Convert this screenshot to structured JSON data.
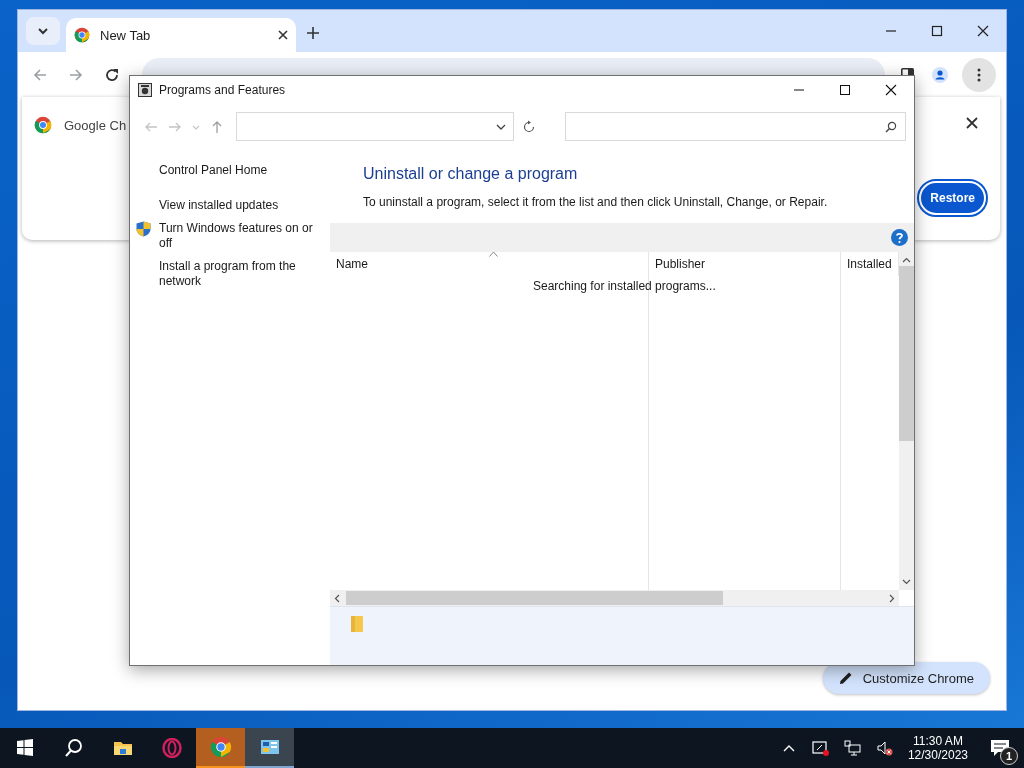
{
  "browser": {
    "tabs": [
      {
        "label": "New Tab",
        "selected": true
      }
    ],
    "card": {
      "site": "Google Ch",
      "button": "Restore"
    },
    "customize_button": "Customize Chrome"
  },
  "dialog": {
    "title": "Programs and Features",
    "sidebar": [
      {
        "label": "Control Panel Home",
        "kind": "link"
      },
      {
        "label": "View installed updates",
        "kind": "link"
      },
      {
        "label": "Turn Windows features on or off",
        "kind": "shield"
      },
      {
        "label": "Install a program from the network",
        "kind": "link"
      }
    ],
    "heading": "Uninstall or change a program",
    "description": "To uninstall a program, select it from the list and then click Uninstall, Change, or Repair.",
    "columns": [
      {
        "label": "Name",
        "sorted": true
      },
      {
        "label": "Publisher",
        "sorted": false
      },
      {
        "label": "Installed",
        "sorted": false
      }
    ],
    "status": "Searching for installed programs..."
  },
  "taskbar": {
    "apps": [
      {
        "kind": "start",
        "flashing": false,
        "active": false
      },
      {
        "kind": "search",
        "flashing": false,
        "active": false
      },
      {
        "kind": "folder",
        "flashing": false,
        "active": false
      },
      {
        "kind": "opera",
        "flashing": false,
        "active": false
      },
      {
        "kind": "chrome",
        "flashing": true,
        "active": false
      },
      {
        "kind": "control-panel",
        "flashing": false,
        "active": true
      }
    ],
    "time": "11:30 AM",
    "date": "12/30/2023",
    "notifications": "1"
  }
}
